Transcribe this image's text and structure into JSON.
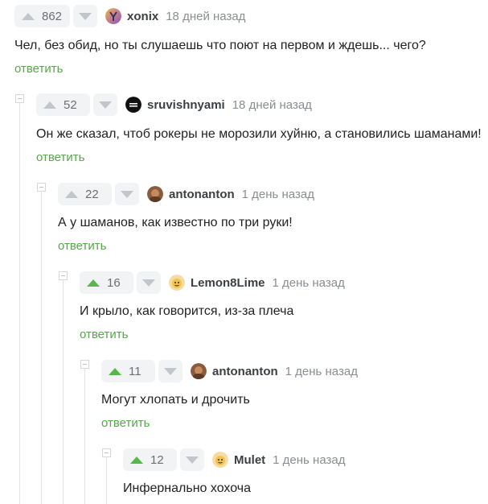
{
  "comments": [
    {
      "rating": "862",
      "upvoted": false,
      "author": "xonix",
      "time": "18 дней назад",
      "text": "Чел, без обид, но ты слушаешь что поют на первом и ждешь... чего?",
      "reply": "ответить",
      "avatar": "avatar-purple-gradient"
    },
    {
      "rating": "52",
      "upvoted": false,
      "author": "sruvishnyami",
      "time": "18 дней назад",
      "text": "Он же сказал, чтоб рокеры не морозили хуйню, а становились шаманами!",
      "reply": "ответить",
      "avatar": "avatar-black-circle"
    },
    {
      "rating": "22",
      "upvoted": false,
      "author": "antonanton",
      "time": "1 день назад",
      "text": "А у шаманов, как известно по три руки!",
      "reply": "ответить",
      "avatar": "avatar-brown-photo"
    },
    {
      "rating": "16",
      "upvoted": true,
      "author": "Lemon8Lime",
      "time": "1 день назад",
      "text": "И крыло, как говорится, из-за плеча",
      "reply": "ответить",
      "avatar": "avatar-yellow-cartoon"
    },
    {
      "rating": "11",
      "upvoted": true,
      "author": "antonanton",
      "time": "1 день назад",
      "text": "Могут хлопать и дрочить",
      "reply": "ответить",
      "avatar": "avatar-brown-photo"
    },
    {
      "rating": "12",
      "upvoted": true,
      "author": "Mulet",
      "time": "1 день назад",
      "text": "Инфернально хохоча",
      "reply": "",
      "avatar": "avatar-yellow-cartoon"
    }
  ],
  "colors": {
    "upvote_active": "#57b84a",
    "reply_link": "#57a64b",
    "vote_bg": "#f2f3f5"
  }
}
